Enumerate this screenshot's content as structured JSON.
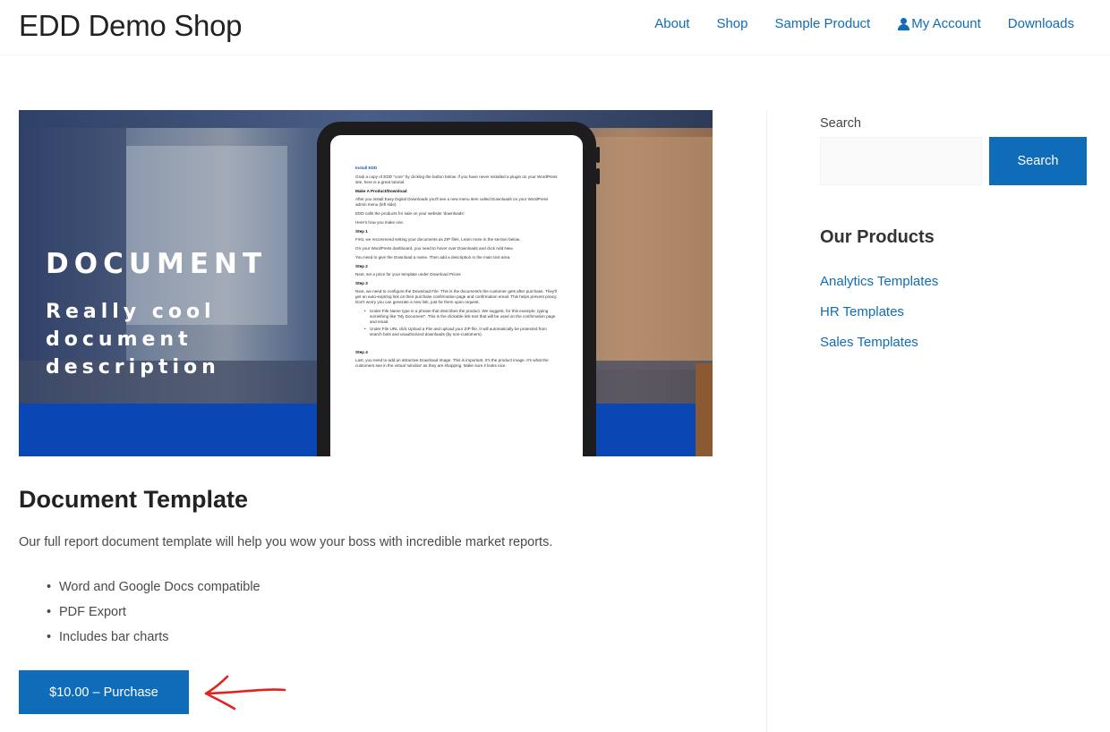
{
  "header": {
    "site_title": "EDD Demo Shop",
    "nav": [
      {
        "label": "About"
      },
      {
        "label": "Shop"
      },
      {
        "label": "Sample Product"
      },
      {
        "label": "My Account",
        "icon": "user-icon"
      },
      {
        "label": "Downloads"
      }
    ]
  },
  "hero": {
    "title": "DOCUMENT",
    "subtitle": "Really cool document description",
    "document": {
      "link": "Install EDD",
      "p1": "Grab a copy of EDD \"core\" by clicking the button below. If you have never installed a plugin on your WordPress site, here is a great tutorial.",
      "h1": "Make A Product/Download",
      "p2": "After you install Easy Digital Downloads you'll see a new menu item called Downloads on your WordPress admin menu (left side).",
      "p3": "EDD calls the products for sale on your website 'downloads'.",
      "p4": "Here's how you make one.",
      "h2": "Step 1",
      "p5": "First, we recommend setting your documents as ZIP files. Learn more in the section below.",
      "p6": "On your WordPress dashboard, you need to hover over Downloads and click Add New.",
      "p7": "You need to give the Download a name. Then add a description in the main text area.",
      "h3": "Step 2",
      "p8": "Next, set a price for your template under Download Prices",
      "h4": "Step 3",
      "p9": "Next, we need to configure the Download File. This is the document/s the customer gets after purchase. They'll get an auto-expiring link on their purchase confirmation page and confirmation email. This helps prevent piracy. Don't worry you can generate a new link, just for them upon request.",
      "b1": "Under File Name type in a phrase that describes the product. We suggest, for this example, typing something like \"My Document\". This is the clickable link text that will be used on the confirmation page and email.",
      "b2": "Under File URL click Upload a File and upload your ZIP file. It will automatically be protected from search bots and unauthorized downloads (by non-customers).",
      "h5": "Step 4",
      "p10": "Last, you need to add an attractive Download Image. This is important. It's the product image. It's what the customers see in the virtual 'window' as they are shopping. Make sure it looks nice."
    }
  },
  "product": {
    "title": "Document Template",
    "description": "Our full report document template will help you wow your boss with incredible market reports.",
    "features": [
      "Word and Google Docs compatible",
      "PDF Export",
      "Includes bar charts"
    ],
    "purchase_label": "$10.00 – Purchase",
    "arrow_color": "#e0231c"
  },
  "sidebar": {
    "search_label": "Search",
    "search_value": "",
    "search_button": "Search",
    "products_title": "Our Products",
    "products": [
      {
        "label": "Analytics Templates"
      },
      {
        "label": "HR Templates"
      },
      {
        "label": "Sales Templates"
      }
    ]
  },
  "colors": {
    "accent": "#0f6cb8",
    "hero_blue": "#0a47b5"
  }
}
